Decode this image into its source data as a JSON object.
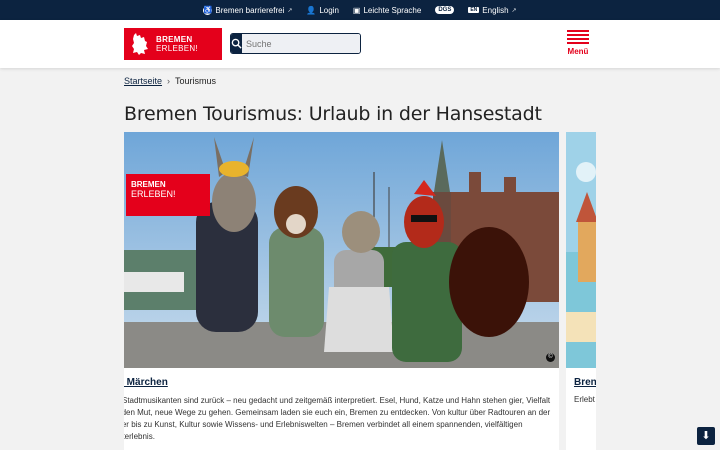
{
  "topbar": {
    "barrierefrei": "Bremen barrierefrei",
    "login": "Login",
    "leichte_sprache": "Leichte Sprache",
    "dgs": "DGS",
    "english": "English"
  },
  "header": {
    "logo_line1": "BREMEN",
    "logo_line2": "ERLEBEN!",
    "search_placeholder": "Suche",
    "menu_label": "Menü"
  },
  "breadcrumb": {
    "home": "Startseite",
    "current": "Tourismus"
  },
  "page_title": "Bremen Tourismus: Urlaub in der Hansestadt",
  "cards": [
    {
      "image_badge_line1": "BREMEN",
      "image_badge_line2": "ERLEBEN!",
      "copyright": "©",
      "title": "als Märchen",
      "text": "mer Stadtmusikanten sind zurück – neu gedacht und zeitgemäß interpretiert. Esel, Hund, Katze und Hahn stehen gier, Vielfalt und den Mut, neue Wege zu gehen. Gemeinsam laden sie euch ein, Bremen zu entdecken. Von kultur über Radtouren an der Weser bis zu Kunst, Kultur sowie Wissens- und Erlebniswelten – Bremen verbindet all einem spannenden, vielfältigen Stadterlebnis."
    },
    {
      "title": "Bren",
      "text": "Erlebt"
    }
  ],
  "colors": {
    "brand_red": "#e4001b",
    "navy": "#0c2340"
  }
}
